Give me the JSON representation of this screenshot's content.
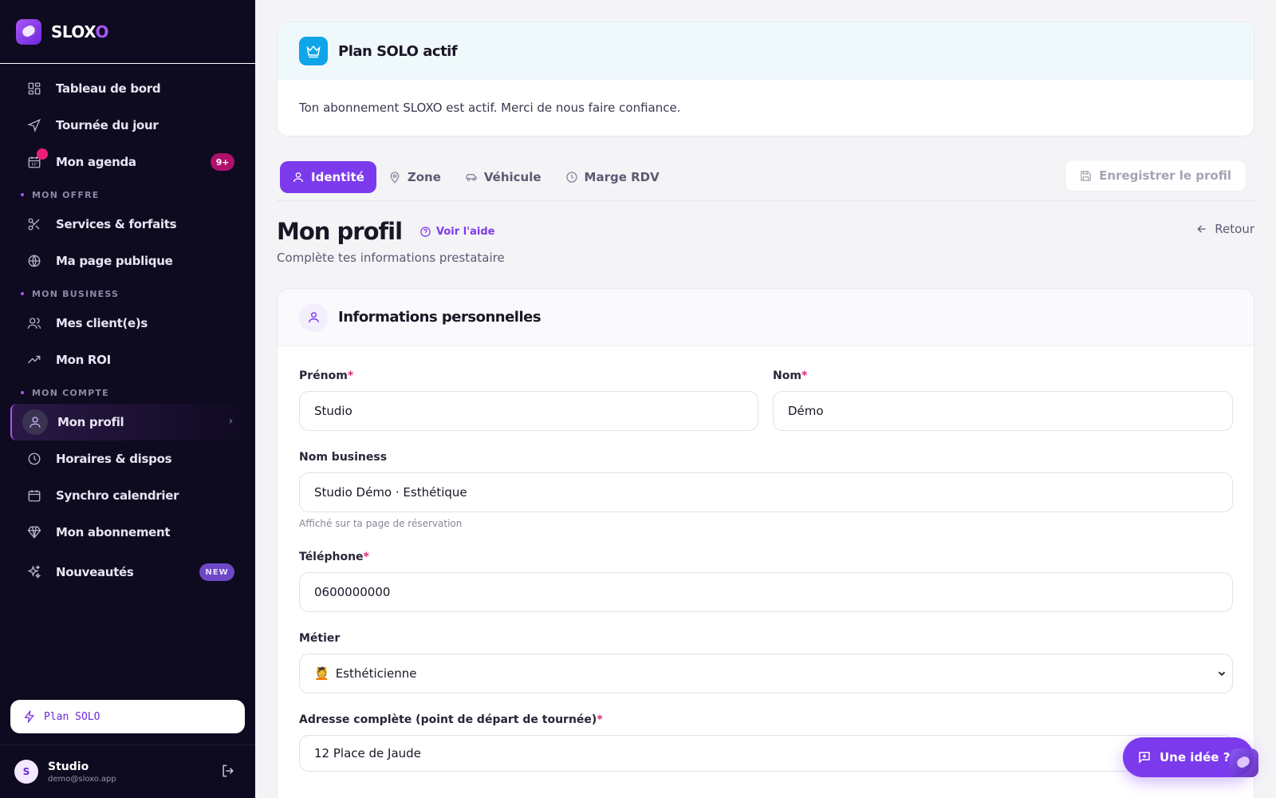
{
  "brand": {
    "name_main": "SLOX",
    "name_accent": "O"
  },
  "sidebar": {
    "items_top": [
      {
        "label": "Tableau de bord",
        "icon": "dashboard-icon"
      },
      {
        "label": "Tournée du jour",
        "icon": "navigation-icon"
      },
      {
        "label": "Mon agenda",
        "icon": "calendar-icon",
        "badge": "9+"
      }
    ],
    "section_offre": "MON OFFRE",
    "items_offre": [
      {
        "label": "Services & forfaits",
        "icon": "scissors-icon"
      },
      {
        "label": "Ma page publique",
        "icon": "globe-icon"
      }
    ],
    "section_business": "MON BUSINESS",
    "items_business": [
      {
        "label": "Mes client(e)s",
        "icon": "users-icon"
      },
      {
        "label": "Mon ROI",
        "icon": "trending-up-icon"
      }
    ],
    "section_compte": "MON COMPTE",
    "items_compte": [
      {
        "label": "Mon profil",
        "icon": "user-icon"
      },
      {
        "label": "Horaires & dispos",
        "icon": "clock-icon"
      },
      {
        "label": "Synchro calendrier",
        "icon": "calendar-sync-icon"
      },
      {
        "label": "Mon abonnement",
        "icon": "diamond-icon"
      },
      {
        "label": "Nouveautés",
        "icon": "sparkles-icon",
        "badge": "NEW"
      }
    ],
    "plan_button": "Plan SOLO",
    "user": {
      "initial": "S",
      "name": "Studio",
      "email": "demo@sloxo.app"
    }
  },
  "plan_card": {
    "title": "Plan SOLO actif",
    "text": "Ton abonnement SLOXO est actif. Merci de nous faire confiance."
  },
  "tabs": [
    {
      "label": "Identité",
      "icon": "user-icon",
      "active": true
    },
    {
      "label": "Zone",
      "icon": "map-pin-icon"
    },
    {
      "label": "Véhicule",
      "icon": "car-icon"
    },
    {
      "label": "Marge RDV",
      "icon": "clock-icon"
    }
  ],
  "save_button": "Enregistrer le profil",
  "page": {
    "title": "Mon profil",
    "help": "Voir l'aide",
    "back": "Retour",
    "subtitle": "Complète tes informations prestataire"
  },
  "form": {
    "title": "Informations personnelles",
    "prenom": {
      "label": "Prénom",
      "required": "*",
      "value": "Studio"
    },
    "nom": {
      "label": "Nom",
      "required": "*",
      "value": "Démo"
    },
    "business": {
      "label": "Nom business",
      "value": "Studio Démo · Esthétique",
      "hint": "Affiché sur ta page de réservation"
    },
    "telephone": {
      "label": "Téléphone",
      "required": "*",
      "value": "0600000000"
    },
    "metier": {
      "label": "Métier",
      "value": "Esthéticienne",
      "emoji": "💆"
    },
    "adresse": {
      "label": "Adresse complète (point de départ de tournée)",
      "required": "*",
      "value": "12 Place de Jaude"
    }
  },
  "fab": {
    "label": "Une idée ?"
  },
  "colors": {
    "accent": "#7c3aed",
    "sidebar_bg": "#0e0a1f",
    "plan_icon": "#0ea5e9",
    "required": "#db2777"
  }
}
